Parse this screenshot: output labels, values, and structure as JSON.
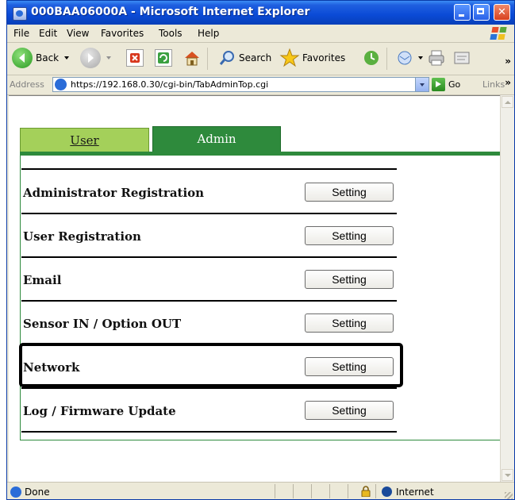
{
  "window": {
    "title": "000BAA06000A - Microsoft Internet Explorer"
  },
  "menu": {
    "file": "File",
    "edit": "Edit",
    "view": "View",
    "favorites": "Favorites",
    "tools": "Tools",
    "help": "Help"
  },
  "toolbar": {
    "back": "Back",
    "search": "Search",
    "favorites": "Favorites"
  },
  "address": {
    "label": "Address",
    "url": "https://192.168.0.30/cgi-bin/TabAdminTop.cgi",
    "go": "Go",
    "links": "Links"
  },
  "tabs": {
    "user": "User",
    "admin": "Admin"
  },
  "rows": [
    {
      "label": "Administrator Registration",
      "button": "Setting"
    },
    {
      "label": "User Registration",
      "button": "Setting"
    },
    {
      "label": "Email",
      "button": "Setting"
    },
    {
      "label": "Sensor IN / Option OUT",
      "button": "Setting"
    },
    {
      "label": "Network",
      "button": "Setting"
    },
    {
      "label": "Log / Firmware Update",
      "button": "Setting"
    }
  ],
  "status": {
    "text": "Done",
    "zone": "Internet"
  }
}
